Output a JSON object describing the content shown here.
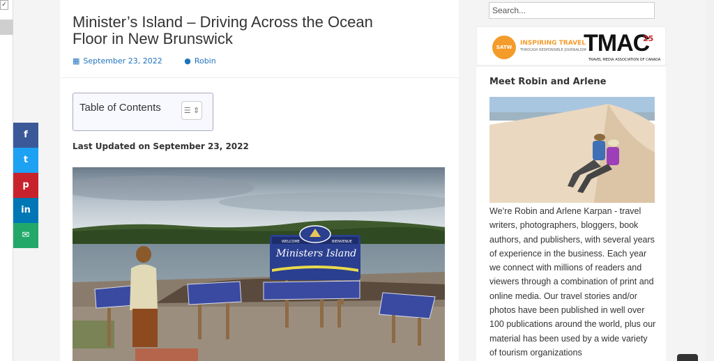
{
  "article": {
    "title": "Minister’s Island – Driving Across the Ocean Floor in New Brunswick",
    "date": "September 23, 2022",
    "author": "Robin",
    "toc_label": "Table of Contents",
    "updated": "Last Updated on September 23, 2022",
    "sign_text": "Ministers Island",
    "sign_welcome": "WELCOME",
    "sign_bienvenue": "BIENVENUE"
  },
  "share": {
    "facebook": "f",
    "twitter": "t",
    "pinterest": "p",
    "linkedin": "in",
    "email": "✉"
  },
  "sidebar": {
    "search_placeholder": "Search...",
    "satw": "SATW",
    "inspiring": "INSPIRING TRAVEL",
    "inspiring_sub": "THROUGH RESPONSIBLE JOURNALISM",
    "tmac": "TMAC",
    "tmac_25": "25",
    "tmac_sub": "TRAVEL MEDIA ASSOCIATION OF CANADA",
    "meet_title": "Meet Robin and Arlene",
    "bio": "We’re Robin and Arlene Karpan - travel writers, photographers, bloggers, book authors, and publishers, with several years of experience in the business. Each year we connect with millions of readers and viewers through a combination of print and online media. Our travel stories and/or photos have been published in well over 100 publications around the world, plus our material has been used by a wide variety of tourism organizations"
  },
  "colors": {
    "link": "#1e73be",
    "facebook": "#3b5998",
    "twitter": "#1da1f2",
    "pinterest": "#c8232c",
    "linkedin": "#0077b5",
    "email": "#22a96a"
  }
}
